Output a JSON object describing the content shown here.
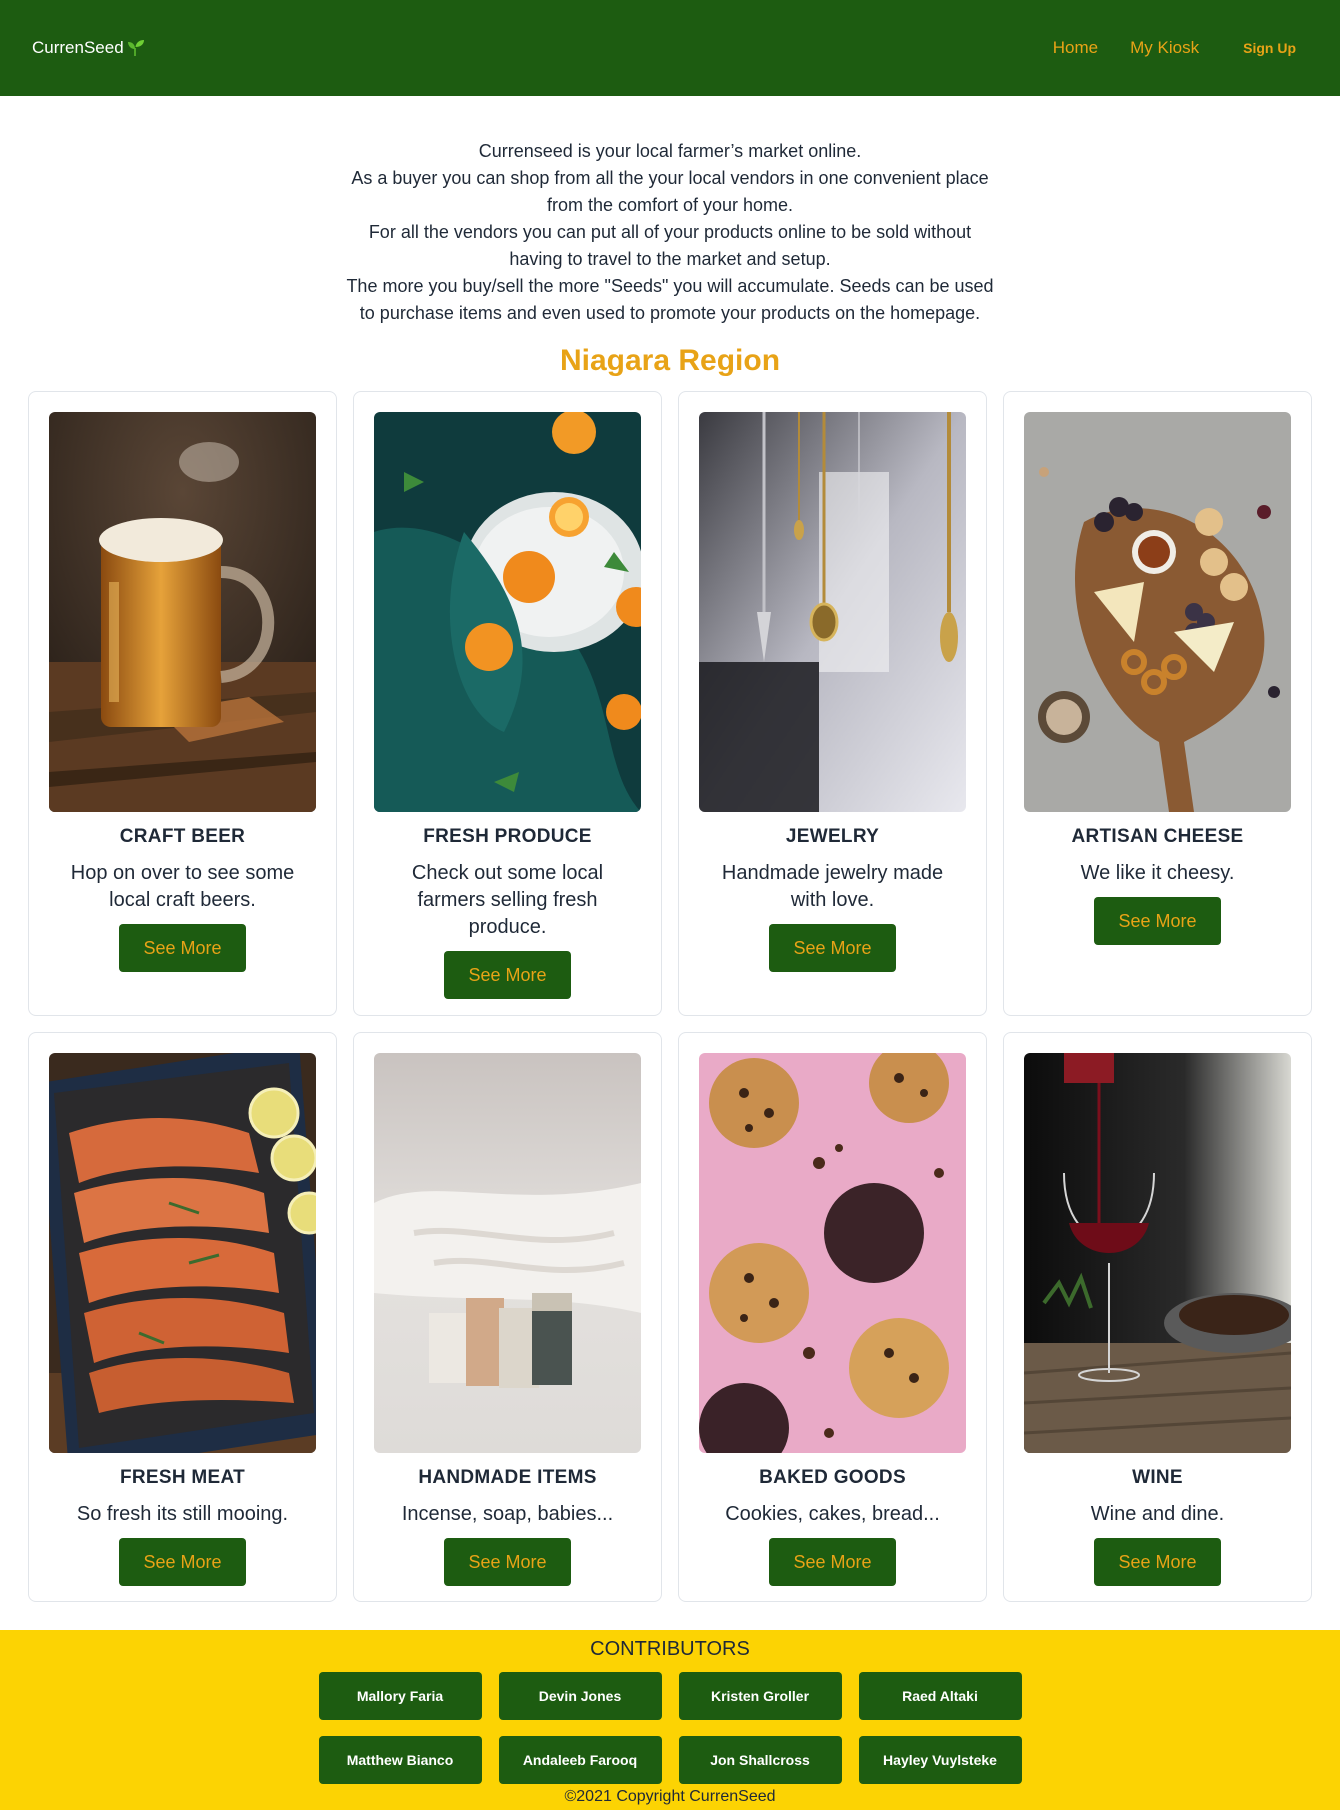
{
  "header": {
    "brand": "CurrenSeed",
    "brand_icon": "sprout-icon",
    "nav": [
      {
        "label": "Home"
      },
      {
        "label": "My Kiosk"
      },
      {
        "label": "Sign Up"
      }
    ]
  },
  "intro": {
    "lines": [
      "Currenseed is your local farmer’s market online.",
      "As a buyer you can shop from all the your local vendors in one convenient place from the comfort of your home.",
      "For all the vendors you can put all of your products online to be sold without having to travel to the market and setup.",
      "The more you buy/sell the more \"Seeds\" you will accumulate. Seeds can be used to purchase items and even used to promote your products on the homepage."
    ]
  },
  "region": {
    "title": "Niagara Region"
  },
  "categories": [
    {
      "title": "CRAFT BEER",
      "description": "Hop on over to see some local craft beers.",
      "button": "See More",
      "image": "beer-mug-photo"
    },
    {
      "title": "FRESH PRODUCE",
      "description": "Check out some local farmers selling fresh produce.",
      "button": "See More",
      "image": "oranges-photo"
    },
    {
      "title": "JEWELRY",
      "description": "Handmade jewelry made with love.",
      "button": "See More",
      "image": "pendants-photo"
    },
    {
      "title": "ARTISAN CHEESE",
      "description": "We like it cheesy.",
      "button": "See More",
      "image": "cheese-board-photo"
    },
    {
      "title": "FRESH MEAT",
      "description": "So fresh its still mooing.",
      "button": "See More",
      "image": "salmon-tray-photo"
    },
    {
      "title": "HANDMADE ITEMS",
      "description": "Incense, soap, babies...",
      "button": "See More",
      "image": "soap-bars-photo"
    },
    {
      "title": "BAKED GOODS",
      "description": "Cookies, cakes, bread...",
      "button": "See More",
      "image": "cookies-photo"
    },
    {
      "title": "WINE",
      "description": "Wine and dine.",
      "button": "See More",
      "image": "wine-glass-photo"
    }
  ],
  "footer": {
    "title": "CONTRIBUTORS",
    "contributors": [
      "Mallory Faria",
      "Devin Jones",
      "Kristen Groller",
      "Raed Altaki",
      "Matthew Bianco",
      "Andaleeb Farooq",
      "Jon Shallcross",
      "Hayley Vuylsteke"
    ],
    "copyright": "©2021 Copyright CurrenSeed"
  },
  "colors": {
    "header_bg": "#1d5c11",
    "accent": "#e8a317",
    "footer_bg": "#fcd303",
    "button_bg": "#1d5c11"
  }
}
